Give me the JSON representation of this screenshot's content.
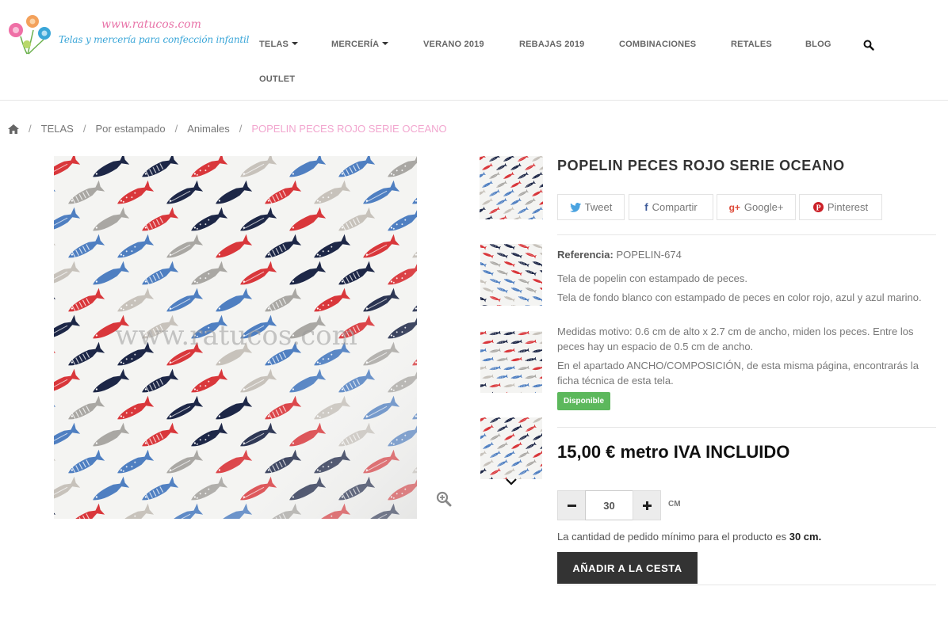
{
  "logo": {
    "url_text": "www.ratucos.com",
    "tagline": "Telas y mercería para confección infantil"
  },
  "nav": {
    "items": [
      "TELAS",
      "MERCERÍA",
      "VERANO 2019",
      "REBAJAS 2019",
      "COMBINACIONES",
      "RETALES",
      "BLOG",
      "OUTLET"
    ]
  },
  "breadcrumb": {
    "items": [
      "TELAS",
      "Por estampado",
      "Animales"
    ],
    "current": "POPELIN PECES ROJO SERIE OCEANO",
    "separator": "/"
  },
  "product": {
    "title": "POPELIN PECES ROJO SERIE OCEANO",
    "watermark": "www.ratucos.com",
    "share": [
      "Tweet",
      "Compartir",
      "Google+",
      "Pinterest"
    ],
    "reference_label": "Referencia:",
    "reference_value": "POPELIN-674",
    "description": [
      "Tela de popelin con estampado de peces.",
      "Tela de fondo blanco con estampado de peces en color rojo, azul y azul marino.",
      "Medidas motivo: 0.6 cm de alto x 2.7 cm de ancho, miden los peces. Entre los peces hay un espacio de 0.5 cm de ancho.",
      "En el apartado ANCHO/COMPOSICIÓN, de esta misma página, encontrarás la ficha técnica de esta tela."
    ],
    "availability": "Disponible",
    "price": "15,00 € metro IVA INCLUIDO",
    "quantity": "30",
    "unit": "CM",
    "min_note_prefix": "La cantidad de pedido mínimo para el producto es",
    "min_note_value": "30 cm.",
    "add_to_cart": "AÑADIR A LA CESTA"
  },
  "colors": {
    "accent_pink": "#f2a6cf",
    "logo_blue": "#3aa6d8",
    "fish_red": "#d9373b",
    "fish_blue": "#4f7fc1",
    "fish_navy": "#1d2747",
    "available_green": "#5cb85c",
    "button_dark": "#333333"
  }
}
